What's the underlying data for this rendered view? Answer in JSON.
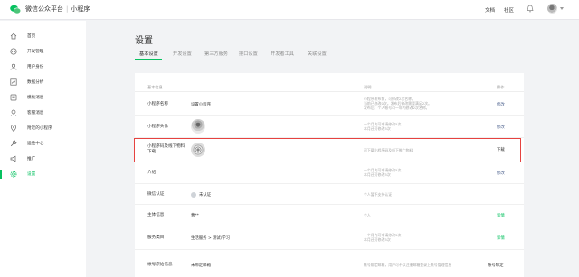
{
  "app": {
    "title": "微信公众平台",
    "separator": "|",
    "product": "小程序"
  },
  "topnav": {
    "docs": "文档",
    "community": "社区"
  },
  "sidebar": {
    "items": [
      {
        "label": "首页",
        "icon": "home-icon"
      },
      {
        "label": "开发管理",
        "icon": "code-icon"
      },
      {
        "label": "用户身份",
        "icon": "user-icon"
      },
      {
        "label": "数据分析",
        "icon": "chart-icon"
      },
      {
        "label": "模板消息",
        "icon": "template-icon"
      },
      {
        "label": "客服消息",
        "icon": "service-icon"
      },
      {
        "label": "附近的小程序",
        "icon": "location-icon"
      },
      {
        "label": "运维中心",
        "icon": "wrench-icon"
      },
      {
        "label": "推广",
        "icon": "megaphone-icon"
      },
      {
        "label": "设置",
        "icon": "gear-icon",
        "active": true
      }
    ]
  },
  "page": {
    "title": "设置"
  },
  "tabs": [
    "基本设置",
    "开发设置",
    "第三方服务",
    "接口设置",
    "开发者工具",
    "关联设置"
  ],
  "table": {
    "headers": {
      "info": "基本信息",
      "desc": "说明",
      "op": "操作"
    },
    "rows": [
      {
        "label": "小程序名称",
        "value": "设置小程序",
        "desc": [
          "小程序发布前，可修改2次名称。",
          "当前已修改0次。发布后修改需要满足2次。",
          "发布后，个人帐号可一年内修改2次名称。"
        ],
        "op": "修改"
      },
      {
        "label": "小程序头像",
        "value": "",
        "desc": [
          "一个月内可申请修改5次",
          "本月还可修改5次"
        ],
        "op": "修改"
      },
      {
        "label": "小程序码及线下物料下载",
        "value": "",
        "desc": [
          "可下载小程序码及线下推广物料"
        ],
        "op": "下载"
      },
      {
        "label": "介绍",
        "value": "",
        "desc": [
          "一个月内可申请修改5次",
          "本月还可修改5次"
        ],
        "op": "修改"
      },
      {
        "label": "微信认证",
        "value": "未认证",
        "desc": [
          "个人暂不支持认证"
        ],
        "op": ""
      },
      {
        "label": "主体信息",
        "value": "曹**",
        "desc": [
          "个人"
        ],
        "op": "详情"
      },
      {
        "label": "服务类目",
        "value": "生活服务 > 测试/学习",
        "desc": [
          "一个月内可申请修改5次",
          "本月还可修改5次"
        ],
        "op": "详情"
      },
      {
        "label": "帐号原始信息",
        "value": "未绑定邮箱",
        "desc": [
          "帐号绑定邮箱，用户可不以注册邮箱登录上帐号管理信息"
        ],
        "op": "帐号绑定"
      }
    ]
  },
  "colors": {
    "accent": "#07c160",
    "link": "#576b95",
    "highlight": "#e64340"
  }
}
